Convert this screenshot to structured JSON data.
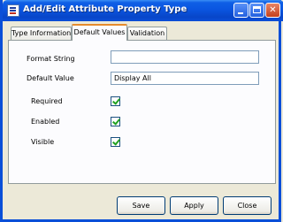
{
  "window": {
    "title": "Add/Edit Attribute Property Type",
    "minimize_label": "minimize",
    "maximize_label": "maximize",
    "close_label": "close"
  },
  "tabs": [
    {
      "label": "Type Information",
      "selected": false
    },
    {
      "label": "Default Values",
      "selected": true
    },
    {
      "label": "Validation",
      "selected": false
    }
  ],
  "form": {
    "format_string": {
      "label": "Format String",
      "value": ""
    },
    "default_value": {
      "label": "Default Value",
      "value": "Display All"
    },
    "required": {
      "label": "Required",
      "checked": true
    },
    "enabled": {
      "label": "Enabled",
      "checked": true
    },
    "visible": {
      "label": "Visible",
      "checked": true
    }
  },
  "buttons": {
    "save": "Save",
    "apply": "Apply",
    "close": "Close"
  },
  "icons": {
    "app": "form-icon",
    "minimize": "minimize-icon",
    "maximize": "maximize-icon",
    "close": "close-x-icon",
    "check": "checkmark-icon"
  },
  "colors": {
    "titlebar": "#0a55e0",
    "window_bg": "#ece9d8",
    "selected_tab_accent": "#e68b2c",
    "check": "#21a121",
    "close_button": "#c4401c"
  }
}
